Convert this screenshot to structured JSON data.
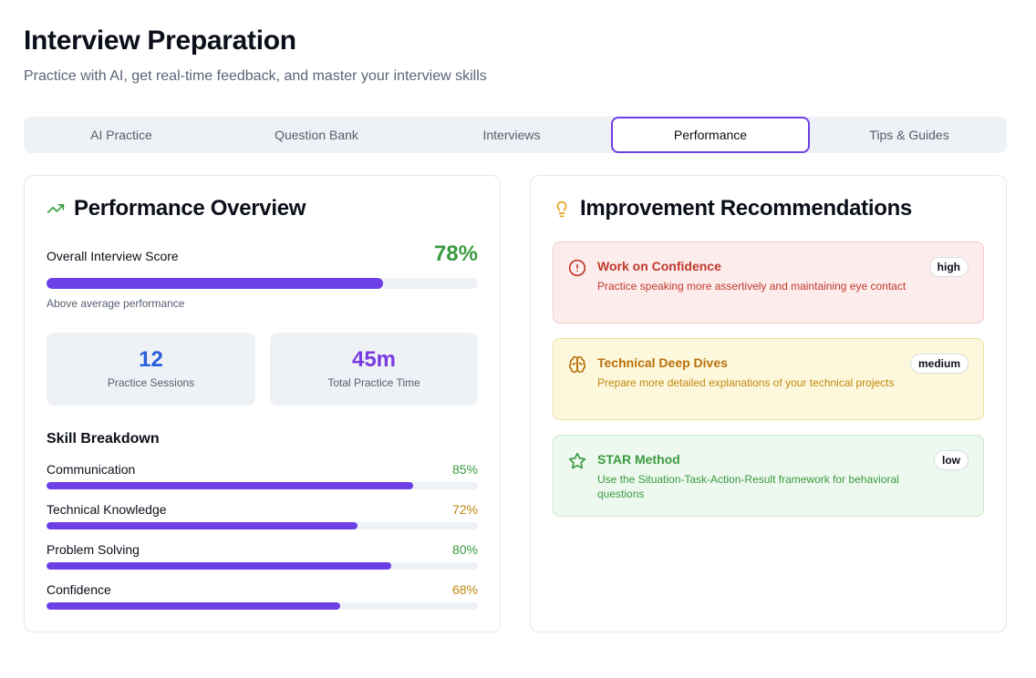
{
  "header": {
    "title": "Interview Preparation",
    "subtitle": "Practice with AI, get real-time feedback, and master your interview skills"
  },
  "tabs": [
    {
      "label": "AI Practice",
      "active": false
    },
    {
      "label": "Question Bank",
      "active": false
    },
    {
      "label": "Interviews",
      "active": false
    },
    {
      "label": "Performance",
      "active": true
    },
    {
      "label": "Tips & Guides",
      "active": false
    }
  ],
  "overview": {
    "icon": "trending-up-icon",
    "title": "Performance Overview",
    "overall_label": "Overall Interview Score",
    "overall_value": "78%",
    "overall_fraction": 0.78,
    "overall_note": "Above average performance",
    "stats": [
      {
        "value": "12",
        "label": "Practice Sessions"
      },
      {
        "value": "45m",
        "label": "Total Practice Time"
      }
    ],
    "skills_title": "Skill Breakdown",
    "skills": [
      {
        "name": "Communication",
        "value": "85%",
        "fraction": 0.85,
        "color": "#3a9a3f"
      },
      {
        "name": "Technical Knowledge",
        "value": "72%",
        "fraction": 0.72,
        "color": "#c0870f"
      },
      {
        "name": "Problem Solving",
        "value": "80%",
        "fraction": 0.8,
        "color": "#3a9a3f"
      },
      {
        "name": "Confidence",
        "value": "68%",
        "fraction": 0.68,
        "color": "#c0870f"
      }
    ]
  },
  "recommendations": {
    "icon": "lightbulb-icon",
    "title": "Improvement Recommendations",
    "items": [
      {
        "icon": "alert-circle-icon",
        "title": "Work on Confidence",
        "description": "Practice speaking more assertively and maintaining eye contact",
        "priority": "high"
      },
      {
        "icon": "brain-icon",
        "title": "Technical Deep Dives",
        "description": "Prepare more detailed explanations of your technical projects",
        "priority": "medium"
      },
      {
        "icon": "star-icon",
        "title": "STAR Method",
        "description": "Use the Situation-Task-Action-Result framework for behavioral questions",
        "priority": "low"
      }
    ]
  },
  "colors": {
    "accent": "#6d3fe6",
    "success": "#3a9a3f",
    "warning": "#c0870f",
    "danger": "#c0392b"
  }
}
